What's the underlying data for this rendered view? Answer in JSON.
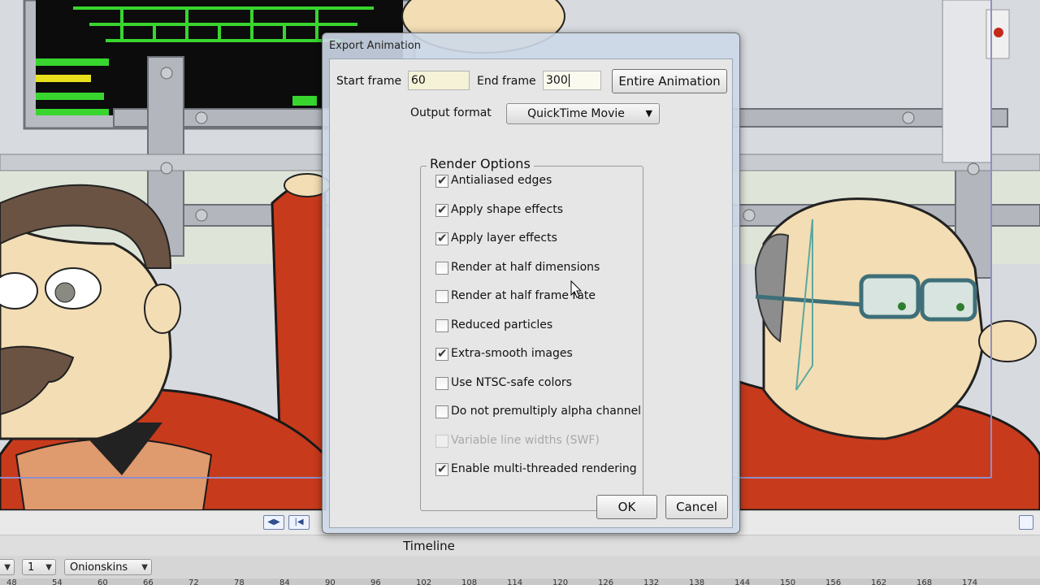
{
  "dialog": {
    "title": "Export Animation",
    "start_frame_label": "Start frame",
    "start_frame_value": "60",
    "end_frame_label": "End frame",
    "end_frame_value": "300",
    "entire_animation_label": "Entire Animation",
    "output_format_label": "Output format",
    "output_format_value": "QuickTime Movie",
    "render_options_title": "Render Options",
    "options": [
      {
        "label": "Antialiased edges",
        "checked": true,
        "enabled": true
      },
      {
        "label": "Apply shape effects",
        "checked": true,
        "enabled": true
      },
      {
        "label": "Apply layer effects",
        "checked": true,
        "enabled": true
      },
      {
        "label": "Render at half dimensions",
        "checked": false,
        "enabled": true
      },
      {
        "label": "Render at half frame rate",
        "checked": false,
        "enabled": true
      },
      {
        "label": "Reduced particles",
        "checked": false,
        "enabled": true
      },
      {
        "label": "Extra-smooth images",
        "checked": true,
        "enabled": true
      },
      {
        "label": "Use NTSC-safe colors",
        "checked": false,
        "enabled": true
      },
      {
        "label": "Do not premultiply alpha channel",
        "checked": false,
        "enabled": true
      },
      {
        "label": "Variable line widths (SWF)",
        "checked": false,
        "enabled": false
      },
      {
        "label": "Enable multi-threaded rendering",
        "checked": true,
        "enabled": true
      }
    ],
    "ok_label": "OK",
    "cancel_label": "Cancel"
  },
  "timeline": {
    "title": "Timeline",
    "onion_count": "1",
    "onionskins_label": "Onionskins",
    "ruler_ticks": [
      "48",
      "54",
      "60",
      "66",
      "72",
      "78",
      "84",
      "90",
      "96",
      "102",
      "108",
      "114",
      "120",
      "126",
      "132",
      "138",
      "144",
      "150",
      "156",
      "162",
      "168",
      "174"
    ]
  },
  "colors": {
    "dialog_frame": "#cdd8e8",
    "dialog_body": "#e6e6e6",
    "field_bg": "#f5f2d8",
    "chair_red": "#c83a1c",
    "skin": "#f3ddb4"
  }
}
